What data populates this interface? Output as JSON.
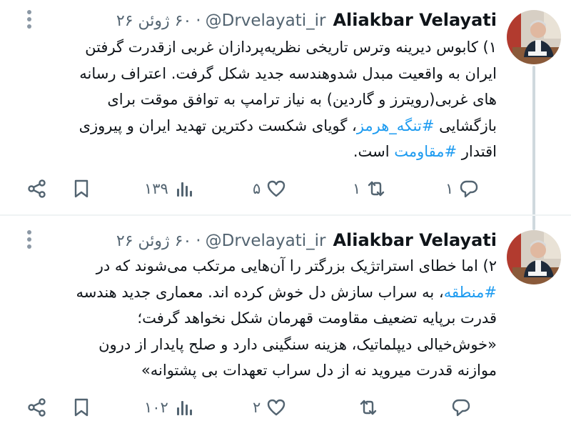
{
  "tweets": [
    {
      "author": "Aliakbar Velayati",
      "handle": "@Drvelayati_ir",
      "separator": "·",
      "date": "۶۰ ژوئن ۲۶",
      "lines": [
        "۱) کابوس دیرینه وترس تاریخی نظریه‌پردازان غربی ازقدرت گرفتن",
        "ایران به واقعیت مبدل شدوهندسه جدید شکل گرفت. اعتراف رسانه",
        "های غربی(رویترز و گاردین) به نیاز ترامپ به توافق موقت برای",
        [
          "بازگشایی ",
          "#تنگه_هرمز",
          "، گویای شکست دکترین تهدید ایران و پیروزی"
        ],
        [
          "اقتدار ",
          "#مقاومت",
          " است."
        ]
      ],
      "stats": {
        "replies": "۱",
        "retweets": "۱",
        "likes": "۵",
        "views": "۱۳۹"
      }
    },
    {
      "author": "Aliakbar Velayati",
      "handle": "@Drvelayati_ir",
      "separator": "·",
      "date": "۶۰ ژوئن ۲۶",
      "lines": [
        "۲) اما خطای استراتژیک بزرگتر را آن‌هایی مرتکب می‌شوند که در",
        [
          "",
          "#منطقه",
          "، به سراب سازش دل خوش کرده اند. معماری جدید هندسه"
        ],
        "قدرت برپایه تضعیف مقاومت قهرمان شکل نخواهد گرفت؛",
        "«خوش‌خیالی دیپلماتیک، هزینه سنگینی دارد و صلح پایدار از درون",
        "موازنه قدرت میروید نه از دل سراب تعهدات بی پشتوانه»"
      ],
      "stats": {
        "replies": "",
        "retweets": "",
        "likes": "۲",
        "views": "۱۰۲"
      }
    }
  ],
  "colors": {
    "text": "#0f1419",
    "secondary": "#536471",
    "hashtag": "#1d9bf0",
    "thread_line": "#cfd9de"
  },
  "icons": [
    "more-vertical-icon",
    "share-icon",
    "bookmark-icon",
    "views-icon",
    "like-icon",
    "retweet-icon",
    "reply-icon"
  ]
}
